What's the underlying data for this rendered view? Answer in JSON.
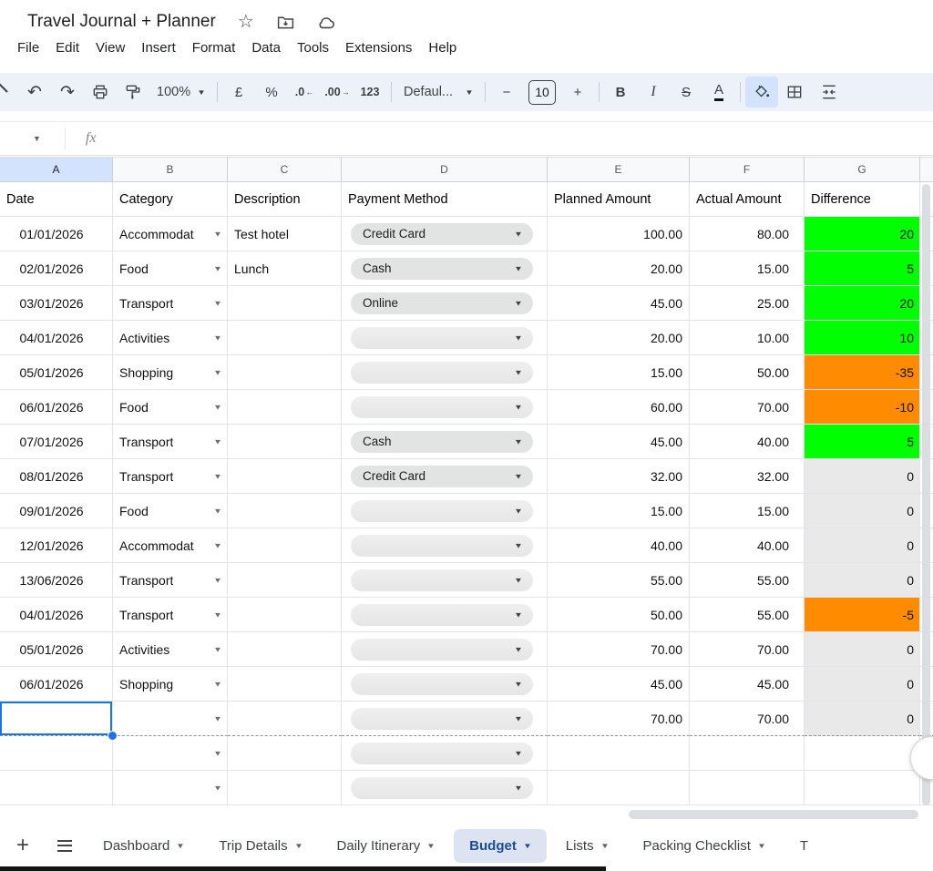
{
  "doc": {
    "title": "Travel Journal + Planner"
  },
  "menus": [
    "File",
    "Edit",
    "View",
    "Insert",
    "Format",
    "Data",
    "Tools",
    "Extensions",
    "Help"
  ],
  "toolbar": {
    "undo": "↶",
    "redo": "↷",
    "zoom": "100%",
    "currency": "£",
    "percent": "%",
    "decimal_decrease": ".0",
    "decimal_increase": ".00",
    "number_format": "123",
    "font_name": "Defaul...",
    "decrease_font": "−",
    "font_size": "10",
    "increase_font": "+",
    "bold": "B",
    "italic": "I",
    "strikethrough": "S",
    "text_color": "A"
  },
  "formula_bar": {
    "fx": "fx"
  },
  "grid": {
    "column_letters": [
      "A",
      "B",
      "C",
      "D",
      "E",
      "F",
      "G",
      ""
    ],
    "field_row": [
      "Date",
      "Category",
      "Description",
      "Payment Method",
      "Planned Amount",
      "Actual Amount",
      "Difference"
    ],
    "rows": [
      {
        "date": "01/01/2026",
        "category": "Accommodat",
        "description": "Test hotel",
        "payment": "Credit Card",
        "planned": "100.00",
        "actual": "80.00",
        "diff": "20",
        "diff_color": "green",
        "selected": false
      },
      {
        "date": "02/01/2026",
        "category": "Food",
        "description": "Lunch",
        "payment": "Cash",
        "planned": "20.00",
        "actual": "15.00",
        "diff": "5",
        "diff_color": "green",
        "selected": false
      },
      {
        "date": "03/01/2026",
        "category": "Transport",
        "description": "",
        "payment": "Online",
        "planned": "45.00",
        "actual": "25.00",
        "diff": "20",
        "diff_color": "green",
        "selected": false
      },
      {
        "date": "04/01/2026",
        "category": "Activities",
        "description": "",
        "payment": "",
        "planned": "20.00",
        "actual": "10.00",
        "diff": "10",
        "diff_color": "green",
        "selected": false
      },
      {
        "date": "05/01/2026",
        "category": "Shopping",
        "description": "",
        "payment": "",
        "planned": "15.00",
        "actual": "50.00",
        "diff": "-35",
        "diff_color": "orange",
        "selected": false
      },
      {
        "date": "06/01/2026",
        "category": "Food",
        "description": "",
        "payment": "",
        "planned": "60.00",
        "actual": "70.00",
        "diff": "-10",
        "diff_color": "orange",
        "selected": false
      },
      {
        "date": "07/01/2026",
        "category": "Transport",
        "description": "",
        "payment": "Cash",
        "planned": "45.00",
        "actual": "40.00",
        "diff": "5",
        "diff_color": "green",
        "selected": false
      },
      {
        "date": "08/01/2026",
        "category": "Transport",
        "description": "",
        "payment": "Credit Card",
        "planned": "32.00",
        "actual": "32.00",
        "diff": "0",
        "diff_color": "gray",
        "selected": false
      },
      {
        "date": "09/01/2026",
        "category": "Food",
        "description": "",
        "payment": "",
        "planned": "15.00",
        "actual": "15.00",
        "diff": "0",
        "diff_color": "gray",
        "selected": false
      },
      {
        "date": "12/01/2026",
        "category": "Accommodat",
        "description": "",
        "payment": "",
        "planned": "40.00",
        "actual": "40.00",
        "diff": "0",
        "diff_color": "gray",
        "selected": false
      },
      {
        "date": "13/06/2026",
        "category": "Transport",
        "description": "",
        "payment": "",
        "planned": "55.00",
        "actual": "55.00",
        "diff": "0",
        "diff_color": "gray",
        "selected": false
      },
      {
        "date": "04/01/2026",
        "category": "Transport",
        "description": "",
        "payment": "",
        "planned": "50.00",
        "actual": "55.00",
        "diff": "-5",
        "diff_color": "orange",
        "selected": false
      },
      {
        "date": "05/01/2026",
        "category": "Activities",
        "description": "",
        "payment": "",
        "planned": "70.00",
        "actual": "70.00",
        "diff": "0",
        "diff_color": "gray",
        "selected": false
      },
      {
        "date": "06/01/2026",
        "category": "Shopping",
        "description": "",
        "payment": "",
        "planned": "45.00",
        "actual": "45.00",
        "diff": "0",
        "diff_color": "gray",
        "selected": false
      },
      {
        "date": "",
        "category": "",
        "description": "",
        "payment": "",
        "planned": "70.00",
        "actual": "70.00",
        "diff": "0",
        "diff_color": "gray",
        "selected": true
      },
      {
        "date": "",
        "category": "",
        "description": "",
        "payment": "",
        "planned": "",
        "actual": "",
        "diff": "",
        "diff_color": null,
        "selected": false
      },
      {
        "date": "",
        "category": "",
        "description": "",
        "payment": "",
        "planned": "",
        "actual": "",
        "diff": "",
        "diff_color": null,
        "selected": false
      }
    ]
  },
  "tabs": {
    "items": [
      {
        "label": "Dashboard",
        "active": false,
        "partial": false
      },
      {
        "label": "Trip Details",
        "active": false,
        "partial": false
      },
      {
        "label": "Daily Itinerary",
        "active": false,
        "partial": false
      },
      {
        "label": "Budget",
        "active": true,
        "partial": false
      },
      {
        "label": "Lists",
        "active": false,
        "partial": false
      },
      {
        "label": "Packing Checklist",
        "active": false,
        "partial": false
      },
      {
        "label": "T",
        "active": false,
        "partial": true
      }
    ]
  },
  "colors": {
    "positive": "#00ff00",
    "negative": "#ff8c00",
    "neutral": "#e9e9e9",
    "selection": "#1a73e8",
    "active_tab_bg": "#dde3f0",
    "active_tab_text": "#1a4c96"
  }
}
